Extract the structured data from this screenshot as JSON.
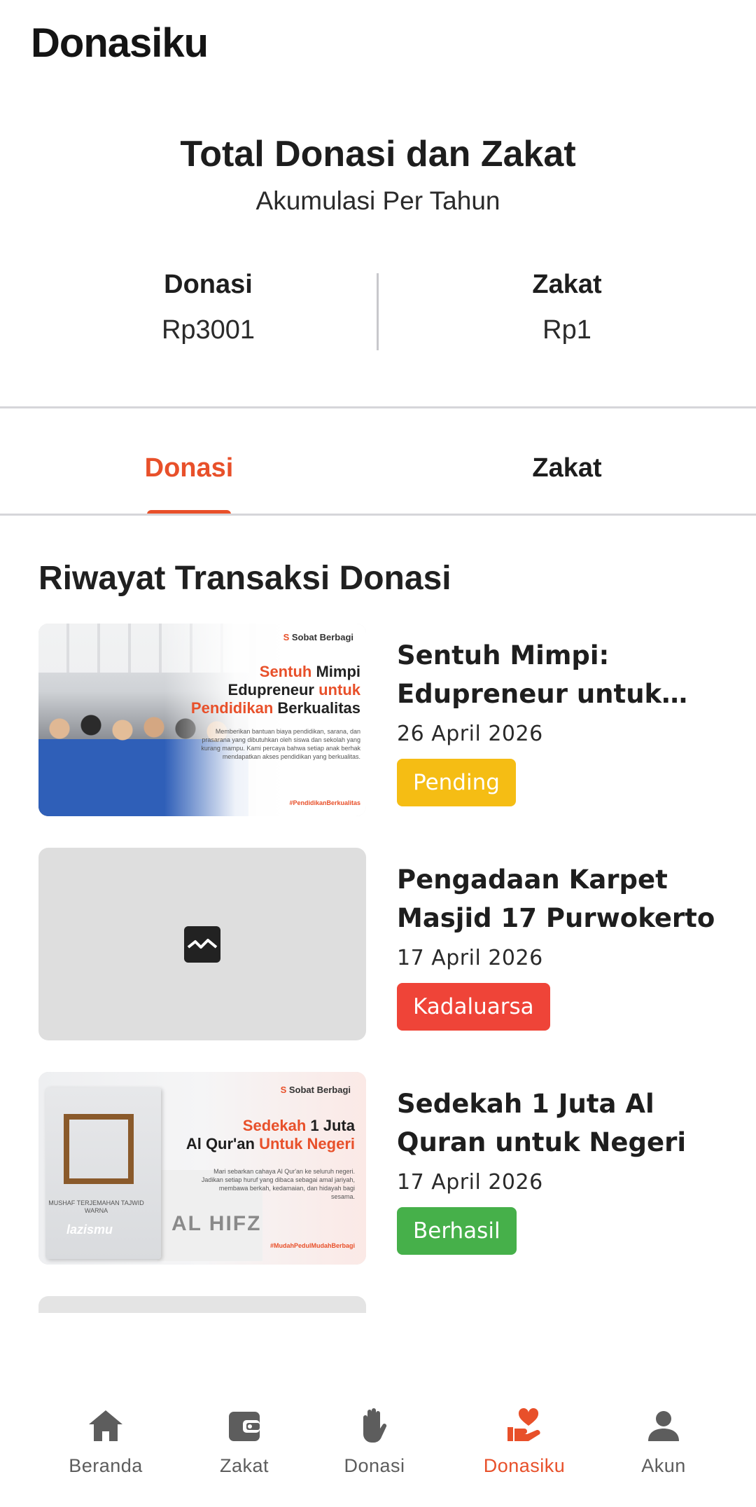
{
  "app": {
    "title": "Donasiku"
  },
  "summary": {
    "title": "Total Donasi dan Zakat",
    "subtitle": "Akumulasi Per Tahun",
    "donasi": {
      "label": "Donasi",
      "value": "Rp3001"
    },
    "zakat": {
      "label": "Zakat",
      "value": "Rp1"
    }
  },
  "tabs": {
    "items": [
      {
        "label": "Donasi",
        "active": true
      },
      {
        "label": "Zakat",
        "active": false
      }
    ],
    "accent_color": "#e8502a"
  },
  "history": {
    "title": "Riwayat Transaksi Donasi",
    "items": [
      {
        "title": "Sentuh Mimpi: Edupreneur untuk Pendidikan Berkualitas",
        "date": "26 April 2026",
        "status": "Pending",
        "status_color": "#f5bd14",
        "thumbnail": {
          "logo": "Sobat Berbagi",
          "headline_1": "Sentuh",
          "headline_2": " Mimpi",
          "headline_3": "Edupreneur ",
          "headline_4": "untuk",
          "headline_5": "Pendidikan",
          "headline_6": " Berkualitas",
          "body": "Memberikan bantuan biaya pendidikan, sarana, dan prasarana yang dibutuhkan oleh siswa dan sekolah yang kurang mampu. Kami percaya bahwa setiap anak berhak mendapatkan akses pendidikan yang berkualitas.",
          "hashtag": "#PendidikanBerkualitas"
        }
      },
      {
        "title": "Pengadaan Karpet Masjid 17 Purwokerto",
        "date": "17 April 2026",
        "status": "Kadaluarsa",
        "status_color": "#ef4438",
        "thumbnail": {
          "icon": "broken-image-icon"
        }
      },
      {
        "title": "Sedekah 1 Juta Al Quran untuk Negeri",
        "date": "17 April 2026",
        "status": "Berhasil",
        "status_color": "#46b04a",
        "thumbnail": {
          "logo": "Sobat Berbagi",
          "headline_1": "Sedekah",
          "headline_2": " 1 Juta",
          "headline_3": "Al Qur'an ",
          "headline_4": "Untuk Negeri",
          "body": "Mari sebarkan cahaya Al Qur'an ke seluruh negeri. Jadikan setiap huruf yang dibaca sebagai amal jariyah, membawa berkah, kedamaian, dan hidayah bagi sesama.",
          "book_text": "MUSHAF TERJEMAHAN TAJWID WARNA",
          "book_logo": "lazismu",
          "book2_text": "AL HIFZ",
          "hashtag": "#MudahPedulMudahBerbagi"
        }
      }
    ]
  },
  "bottom_nav": {
    "items": [
      {
        "label": "Beranda",
        "icon": "home-icon",
        "active": false
      },
      {
        "label": "Zakat",
        "icon": "wallet-icon",
        "active": false
      },
      {
        "label": "Donasi",
        "icon": "hand-icon",
        "active": false
      },
      {
        "label": "Donasiku",
        "icon": "heart-hand-icon",
        "active": true
      },
      {
        "label": "Akun",
        "icon": "person-icon",
        "active": false
      }
    ],
    "active_color": "#e8502a",
    "inactive_color": "#5d5d5d"
  }
}
